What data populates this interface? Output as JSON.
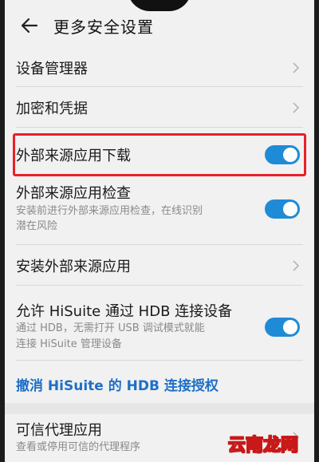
{
  "header": {
    "title": "更多安全设置",
    "back_icon": "arrow-left-icon"
  },
  "items": [
    {
      "label": "设备管理器",
      "control": "chevron"
    },
    {
      "label": "加密和凭据",
      "control": "chevron"
    },
    {
      "label": "外部来源应用下载",
      "control": "toggle",
      "on": true,
      "highlighted": true
    },
    {
      "label": "外部来源应用检查",
      "sub1": "安装前进行外部来源应用检查，在线识别",
      "sub2": "潜在风险",
      "control": "toggle",
      "on": true
    },
    {
      "label": "安装外部来源应用",
      "control": "chevron"
    },
    {
      "label": "允许 HiSuite 通过 HDB 连接设备",
      "sub1": "通过 HDB，无需打开 USB 调试模式就能",
      "sub2": "连接 HiSuite 管理设备",
      "control": "toggle",
      "on": true
    },
    {
      "label": "可信代理应用",
      "sub1": "查看或停用可信的代理程序",
      "control": "chevron"
    }
  ],
  "revoke_link": "撤消 HiSuite 的 HDB 连接授权",
  "watermark": "云南龙网",
  "colors": {
    "accent": "#1f8bd6",
    "link": "#1e6fc7",
    "highlight": "#e8202a"
  }
}
